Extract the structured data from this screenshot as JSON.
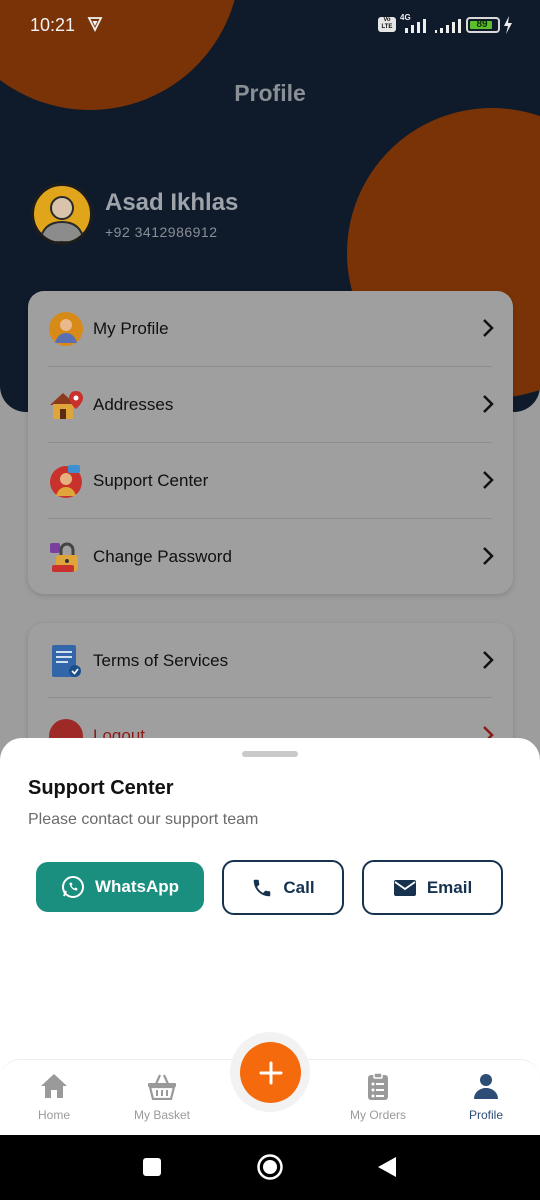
{
  "status_bar": {
    "time": "10:21",
    "volte": "Vo LTE",
    "network": "4G",
    "battery_level": 89,
    "battery_label": "89"
  },
  "header": {
    "title": "Profile"
  },
  "user": {
    "name": "Asad Ikhlas",
    "phone": "+92 3412986912"
  },
  "menu_primary": [
    {
      "label": "My Profile",
      "icon": "user-avatar-icon"
    },
    {
      "label": "Addresses",
      "icon": "house-location-icon"
    },
    {
      "label": "Support Center",
      "icon": "support-agent-icon"
    },
    {
      "label": "Change Password",
      "icon": "padlock-icon"
    }
  ],
  "menu_secondary": [
    {
      "label": "Terms of Services",
      "icon": "document-check-icon"
    },
    {
      "label": "Logout",
      "icon": "logout-icon"
    }
  ],
  "sheet": {
    "title": "Support Center",
    "subtitle": "Please contact our support team",
    "buttons": {
      "whatsapp": "WhatsApp",
      "call": "Call",
      "email": "Email"
    }
  },
  "bottom_nav": {
    "items": [
      {
        "label": "Home",
        "icon": "home-icon"
      },
      {
        "label": "My Basket",
        "icon": "basket-icon"
      },
      {
        "label": "My Orders",
        "icon": "clipboard-list-icon"
      },
      {
        "label": "Profile",
        "icon": "person-icon"
      }
    ],
    "active": "Profile",
    "fab_icon": "plus-icon"
  },
  "colors": {
    "header_bg": "#0f1a2b",
    "accent_orange": "#f56a0c",
    "whatsapp_green": "#1b8f7f",
    "navy": "#17324f",
    "active_nav": "#2d4d76"
  }
}
